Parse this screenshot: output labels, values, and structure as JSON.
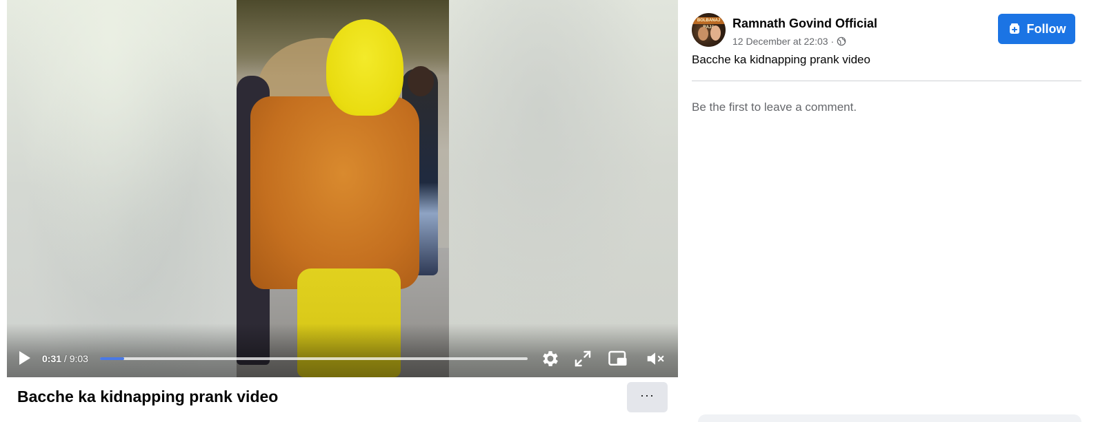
{
  "video": {
    "current_time": "0:31",
    "separator": " / ",
    "duration": "9:03",
    "progress_fraction": 0.057,
    "accent_color": "#4a79e6",
    "controls": {
      "play_icon": "play-icon",
      "settings_icon": "gear-icon",
      "fullscreen_icon": "expand-icon",
      "pip_icon": "picture-in-picture-icon",
      "mute_icon": "muted-speaker-icon"
    }
  },
  "post": {
    "title": "Bacche ka kidnapping prank video",
    "more_label": "···"
  },
  "page": {
    "name": "Ramnath Govind Official",
    "timestamp": "12 December at 22:03",
    "meta_separator": "·",
    "audience_icon": "globe-icon",
    "avatar_text": "BOLBANAJ RAJA",
    "follow_label": "Follow",
    "follow_color": "#1b74e4",
    "description": "Bacche ka kidnapping prank video"
  },
  "comments": {
    "empty_text": "Be the first to leave a comment."
  }
}
